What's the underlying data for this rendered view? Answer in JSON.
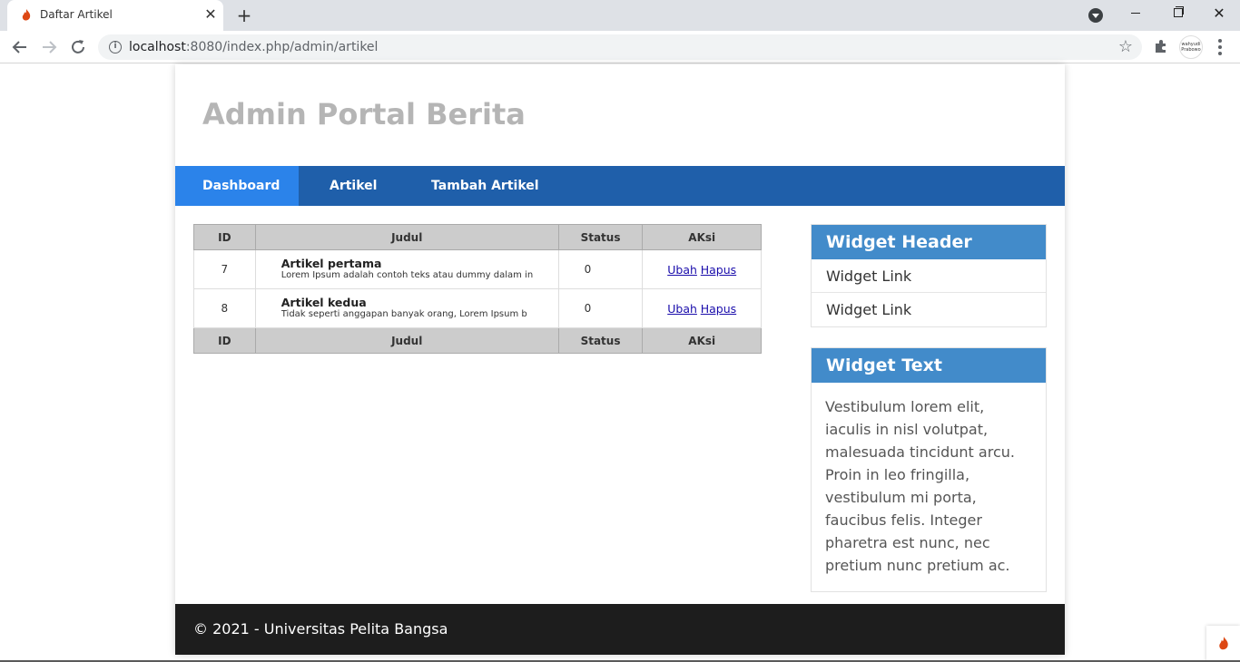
{
  "browser": {
    "tab_title": "Daftar Artikel",
    "url_host": "localhost",
    "url_rest": ":8080/index.php/admin/artikel",
    "avatar_text": "wahyudi Prabowo"
  },
  "site": {
    "title": "Admin Portal Berita"
  },
  "nav": {
    "items": [
      {
        "label": "Dashboard"
      },
      {
        "label": "Artikel"
      },
      {
        "label": "Tambah Artikel"
      }
    ]
  },
  "table": {
    "headers": [
      "ID",
      "Judul",
      "Status",
      "AKsi"
    ],
    "rows": [
      {
        "id": "7",
        "title": "Artikel pertama",
        "desc": "Lorem Ipsum adalah contoh teks atau dummy dalam in",
        "status": "0",
        "edit": "Ubah",
        "delete": "Hapus"
      },
      {
        "id": "8",
        "title": "Artikel kedua",
        "desc": "Tidak seperti anggapan banyak orang, Lorem Ipsum b",
        "status": "0",
        "edit": "Ubah",
        "delete": "Hapus"
      }
    ]
  },
  "sidebar": {
    "widget1": {
      "header": "Widget Header",
      "links": [
        "Widget Link",
        "Widget Link"
      ]
    },
    "widget2": {
      "header": "Widget Text",
      "text": "Vestibulum lorem elit, iaculis in nisl volutpat, malesuada tincidunt arcu. Proin in leo fringilla, vestibulum mi porta, faucibus felis. Integer pharetra est nunc, nec pretium nunc pretium ac."
    }
  },
  "footer": {
    "text": "© 2021 - Universitas Pelita Bangsa"
  },
  "colors": {
    "nav_bg": "#1f5faa",
    "nav_active": "#2b83ea",
    "widget_header": "#428bca",
    "footer_bg": "#1d1d1d",
    "site_title": "#b5b5b5"
  }
}
